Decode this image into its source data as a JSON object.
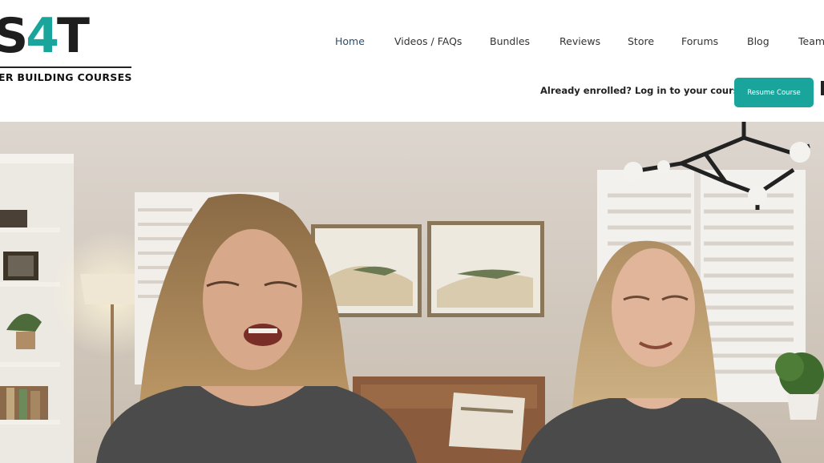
{
  "logo": {
    "mark_prefix": "S",
    "mark_accent": "4",
    "mark_suffix": "T",
    "tagline": "ER BUILDING COURSES"
  },
  "nav": {
    "items": [
      {
        "label": "Home",
        "active": true
      },
      {
        "label": "Videos / FAQs"
      },
      {
        "label": "Bundles"
      },
      {
        "label": "Reviews"
      },
      {
        "label": "Store"
      },
      {
        "label": "Forums"
      },
      {
        "label": "Blog"
      },
      {
        "label": "Team"
      }
    ]
  },
  "header": {
    "enroll_text": "Already enrolled? Log in to your course",
    "resume_button": "Resume Course"
  },
  "colors": {
    "accent": "#1aa59c",
    "nav_active": "#2c4f6e",
    "text": "#222222"
  },
  "hero": {
    "image": "video-still-two-women-living-room"
  }
}
